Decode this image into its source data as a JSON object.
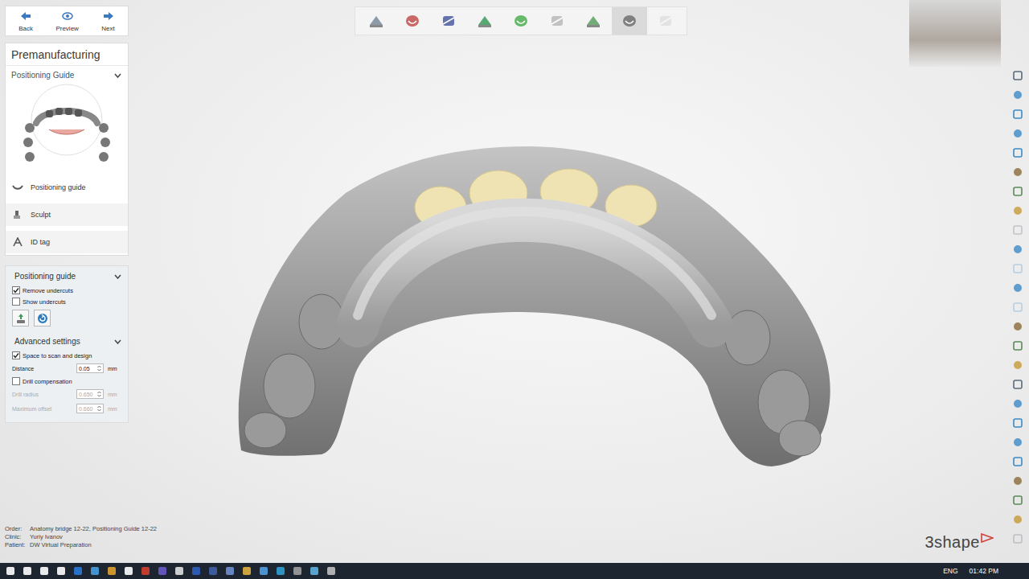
{
  "nav": [
    {
      "label": "Back",
      "disabled": false
    },
    {
      "label": "Preview",
      "disabled": false
    },
    {
      "label": "Next",
      "disabled": false
    }
  ],
  "panel_title": "Premanufacturing",
  "workflow": {
    "title": "Positioning Guide",
    "expanded": true
  },
  "steps": [
    {
      "label": "Positioning guide",
      "selected": true
    },
    {
      "label": "Sculpt",
      "selected": false
    },
    {
      "label": "ID tag",
      "selected": false
    }
  ],
  "positioning_section": {
    "title": "Positioning guide",
    "expanded": true,
    "options": [
      {
        "label": "Remove undercuts",
        "checked": true
      },
      {
        "label": "Show undercuts",
        "checked": false
      }
    ]
  },
  "advanced": {
    "title": "Advanced settings",
    "expanded": true,
    "rows": [
      {
        "kind": "checkbox",
        "label": "Space to scan and design",
        "checked": true,
        "disabled": false
      },
      {
        "kind": "number",
        "label": "Distance",
        "value": "0.05",
        "unit": "mm",
        "disabled": false
      },
      {
        "kind": "checkbox",
        "label": "Drill compensation",
        "checked": false,
        "disabled": false
      },
      {
        "kind": "number",
        "label": "Drill radius",
        "value": "0.650",
        "unit": "mm",
        "disabled": true
      },
      {
        "kind": "number",
        "label": "Maximum offset",
        "value": "0.660",
        "unit": "mm",
        "disabled": true
      }
    ]
  },
  "toolbar": [
    {
      "selected": false,
      "disabled": false
    },
    {
      "selected": false,
      "disabled": false
    },
    {
      "selected": false,
      "disabled": false
    },
    {
      "selected": false,
      "disabled": false
    },
    {
      "selected": false,
      "disabled": false
    },
    {
      "selected": false,
      "disabled": false
    },
    {
      "selected": false,
      "disabled": false
    },
    {
      "selected": true,
      "disabled": false
    },
    {
      "selected": false,
      "disabled": true
    }
  ],
  "right_tools": [
    {
      "disabled": false
    },
    {
      "disabled": false
    },
    {
      "disabled": false
    },
    {
      "disabled": false
    },
    {
      "disabled": false
    },
    {
      "disabled": false
    },
    {
      "disabled": false
    },
    {
      "disabled": false
    },
    {
      "disabled": true
    },
    {
      "disabled": false
    },
    {
      "disabled": true
    },
    {
      "disabled": false
    },
    {
      "disabled": true
    },
    {
      "disabled": false
    },
    {
      "disabled": false
    },
    {
      "disabled": false
    },
    {
      "disabled": false
    },
    {
      "disabled": false
    },
    {
      "disabled": false
    },
    {
      "disabled": false
    },
    {
      "disabled": false
    },
    {
      "disabled": false
    },
    {
      "disabled": false
    },
    {
      "disabled": false
    },
    {
      "disabled": true
    }
  ],
  "info": [
    {
      "label": "Order:",
      "value": "Anatomy bridge 12-22, Positioning Guide 12-22"
    },
    {
      "label": "Clinic:",
      "value": "Yuriy Ivanov"
    },
    {
      "label": "Patient:",
      "value": "DW Virtual Preparation"
    }
  ],
  "logo": "3shape",
  "taskbar": {
    "language": "ENG",
    "time": "01:42 PM"
  }
}
